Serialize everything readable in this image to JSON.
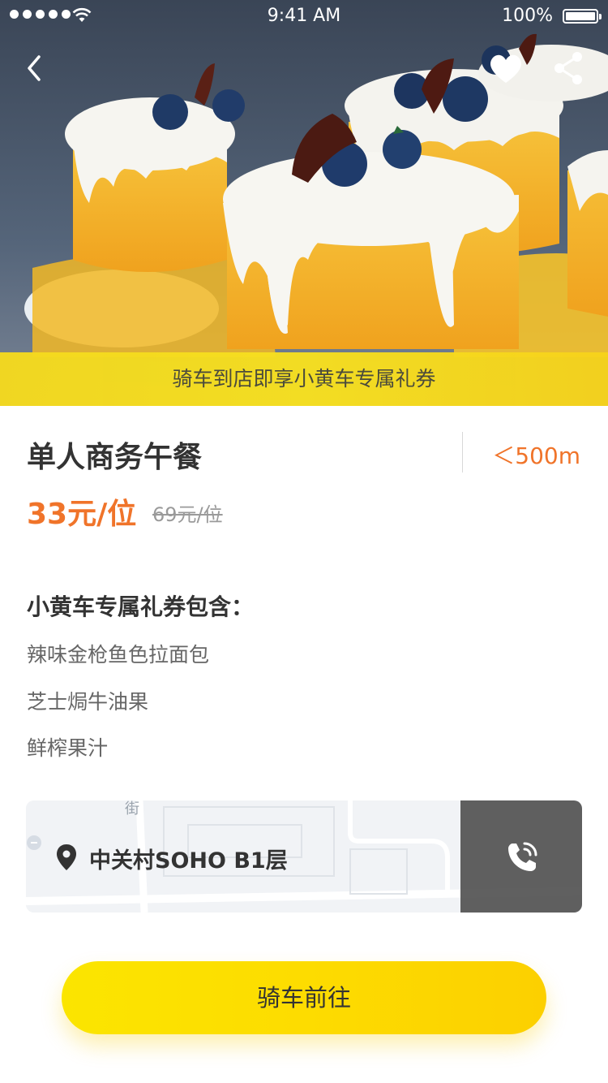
{
  "status_bar": {
    "time": "9:41 AM",
    "battery": "100%"
  },
  "hero": {
    "image_alt": "cakes with blueberries photo",
    "promo_text": "骑车到店即享小黄车专属礼券",
    "icons": {
      "back": "chevron-left-icon",
      "favorite": "heart-icon",
      "share": "share-icon"
    }
  },
  "deal": {
    "title": "单人商务午餐",
    "distance": "＜500m",
    "price": "33元/位",
    "original_price": "69元/位"
  },
  "coupon": {
    "heading": "小黄车专属礼券包含：",
    "items": [
      "辣味金枪鱼色拉面包",
      "芝士焗牛油果",
      "鲜榨果汁"
    ]
  },
  "location": {
    "map_street_label": "街",
    "address": "中关村SOHO B1层",
    "icons": {
      "pin": "location-pin-icon",
      "call": "phone-call-icon"
    }
  },
  "cta": {
    "label": "骑车前往"
  },
  "colors": {
    "accent_orange": "#f0742a",
    "brand_yellow": "#fbe000",
    "text_dark": "#333333",
    "text_gray": "#666666"
  }
}
